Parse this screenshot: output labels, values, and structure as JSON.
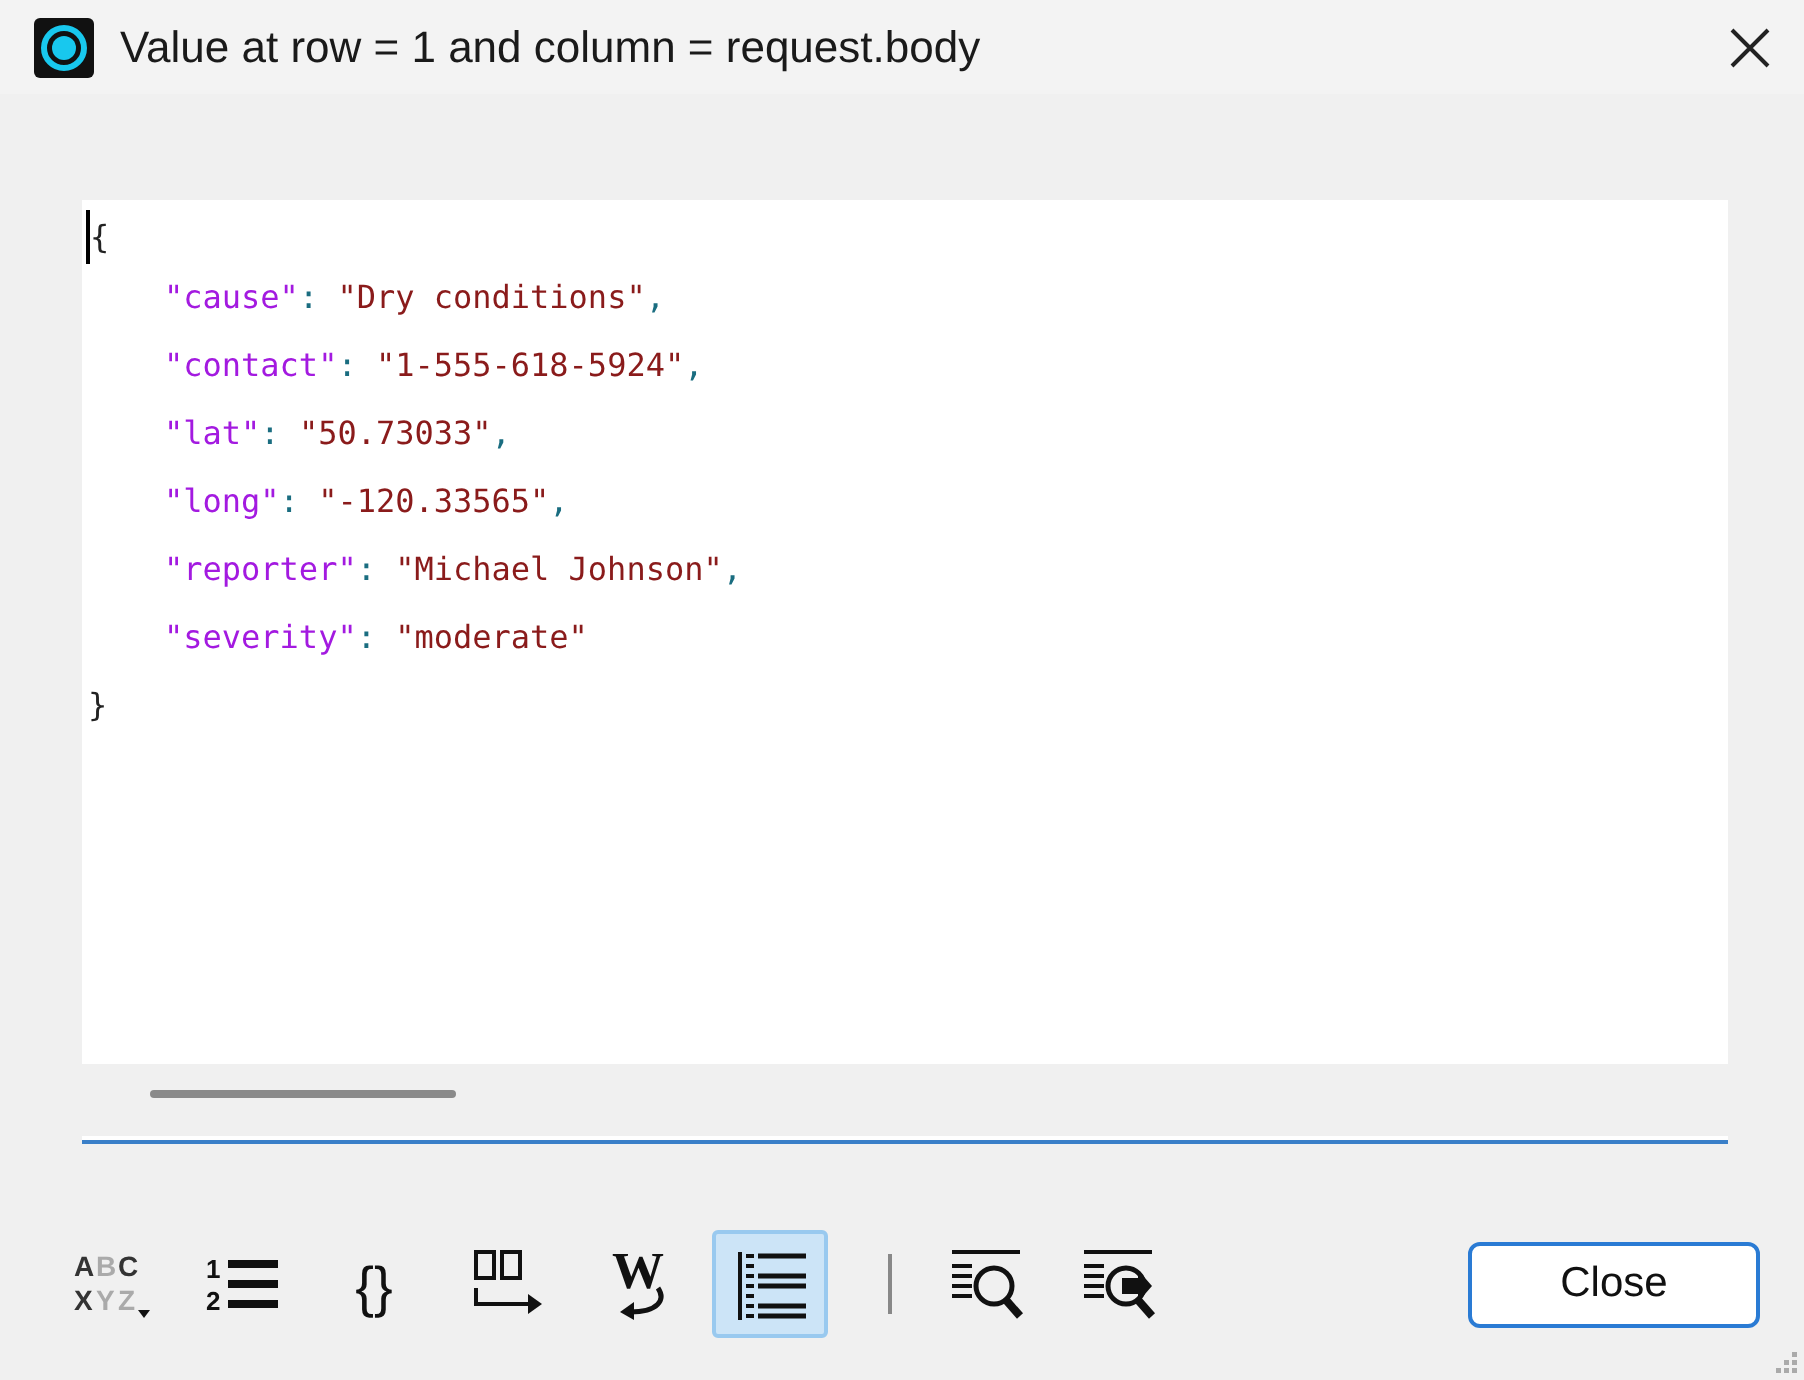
{
  "window": {
    "title": "Value at row = 1 and column = request.body"
  },
  "editor": {
    "lines": [
      {
        "kind": "brace",
        "text": "{"
      },
      {
        "kind": "pair",
        "key": "\"cause\"",
        "sep": ":",
        "value": "\"Dry conditions\"",
        "comma": ","
      },
      {
        "kind": "pair",
        "key": "\"contact\"",
        "sep": ":",
        "value": "\"1-555-618-5924\"",
        "comma": ","
      },
      {
        "kind": "pair",
        "key": "\"lat\"",
        "sep": ":",
        "value": "\"50.73033\"",
        "comma": ","
      },
      {
        "kind": "pair",
        "key": "\"long\"",
        "sep": ":",
        "value": "\"-120.33565\"",
        "comma": ","
      },
      {
        "kind": "pair",
        "key": "\"reporter\"",
        "sep": ":",
        "value": "\"Michael Johnson\"",
        "comma": ","
      },
      {
        "kind": "pair",
        "key": "\"severity\"",
        "sep": ":",
        "value": "\"moderate\""
      },
      {
        "kind": "brace",
        "text": "}"
      }
    ]
  },
  "toolbar": [
    {
      "kind": "case",
      "glyphs": [
        "A",
        "B",
        "C",
        "X",
        "Y",
        "Z"
      ],
      "selected": false
    },
    {
      "kind": "numbered",
      "glyphs": [
        "1",
        "2"
      ],
      "selected": false
    },
    {
      "kind": "braces",
      "glyphs": [
        "{}"
      ],
      "selected": false
    },
    {
      "kind": "columns",
      "selected": false
    },
    {
      "kind": "wrap",
      "glyphs": [
        "W"
      ],
      "selected": false
    },
    {
      "kind": "indent",
      "selected": true
    },
    {
      "kind": "separator"
    },
    {
      "kind": "find",
      "selected": false
    },
    {
      "kind": "findnext",
      "selected": false
    }
  ],
  "buttons": [
    {
      "label": "Close"
    }
  ]
}
